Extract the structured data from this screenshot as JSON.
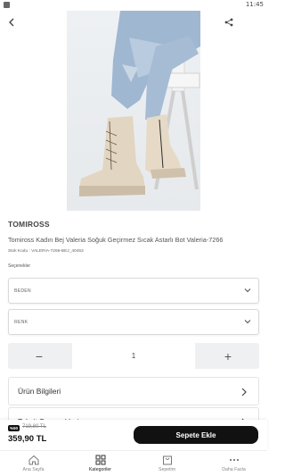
{
  "status_bar": {
    "time": "11:45"
  },
  "product": {
    "brand": "TOMIROSS",
    "title": "Tomiross Kadın Bej Valeria Soğuk Geçirmez Sıcak Astarlı Bot Valeria-7266",
    "sku": "Stok Kodu : VALERIA-7266-BEJ_40453",
    "options_label": "Seçenekler"
  },
  "selects": {
    "size_label": "BEDEN",
    "color_label": "RENK"
  },
  "quantity": {
    "value": "1",
    "minus": "−",
    "plus": "+"
  },
  "accordions": [
    {
      "label": "Ürün Bilgileri"
    },
    {
      "label": "Taksit Seçenekleri"
    }
  ],
  "pricing": {
    "discount_badge": "%50",
    "old_price": "719,80 TL",
    "new_price": "359,90 TL",
    "add_to_cart": "Sepete Ekle"
  },
  "bottom_nav": [
    {
      "label": "Ana Sayfa",
      "icon": "home-icon",
      "active": false
    },
    {
      "label": "Kategoriler",
      "icon": "grid-icon",
      "active": true
    },
    {
      "label": "Sepetim",
      "icon": "cart-icon",
      "active": false
    },
    {
      "label": "Daha Fazla",
      "icon": "more-dots-icon",
      "active": false
    }
  ]
}
